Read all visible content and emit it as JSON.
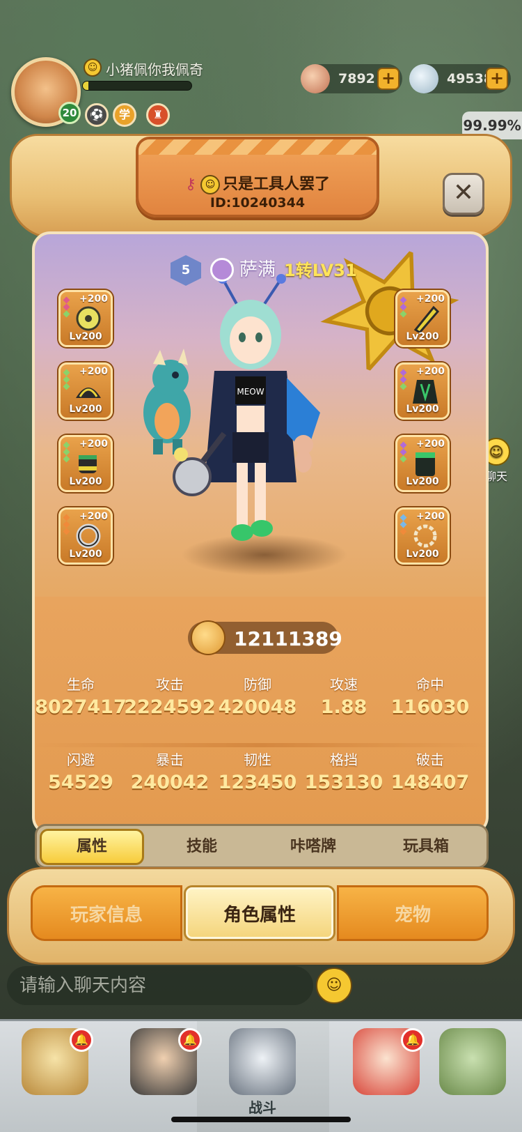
{
  "hud": {
    "player_name": "小猪佩你我佩奇",
    "level": "20",
    "exp_fraction": 0.05,
    "currency": [
      {
        "icon": "meat-icon",
        "value": "7892"
      },
      {
        "icon": "gem-icon",
        "value": "49538"
      }
    ],
    "percent": "99.99%",
    "side_chat_label": "聊天"
  },
  "panel": {
    "player_name": "只是工具人罢了",
    "id_text": "ID:10240344",
    "close_glyph": "✕",
    "rank": "5",
    "class_name": "萨满",
    "class_level": "1转LV31",
    "equipment_left": [
      {
        "plus": "+200",
        "level": "Lv200",
        "item": "cymbal"
      },
      {
        "plus": "+200",
        "level": "Lv200",
        "item": "shoulder-guard"
      },
      {
        "plus": "+200",
        "level": "Lv200",
        "item": "gloves"
      },
      {
        "plus": "+200",
        "level": "Lv200",
        "item": "ring"
      }
    ],
    "equipment_right": [
      {
        "plus": "+200",
        "level": "Lv200",
        "item": "feather"
      },
      {
        "plus": "+200",
        "level": "Lv200",
        "item": "cloak"
      },
      {
        "plus": "+200",
        "level": "Lv200",
        "item": "armor"
      },
      {
        "plus": "+200",
        "level": "Lv200",
        "item": "bracelet"
      }
    ],
    "power": "12111389",
    "stats_row1": [
      {
        "label": "生命",
        "value": "8027417"
      },
      {
        "label": "攻击",
        "value": "2224592"
      },
      {
        "label": "防御",
        "value": "420048"
      },
      {
        "label": "攻速",
        "value": "1.88"
      },
      {
        "label": "命中",
        "value": "116030"
      }
    ],
    "stats_row2": [
      {
        "label": "闪避",
        "value": "54529"
      },
      {
        "label": "暴击",
        "value": "240042"
      },
      {
        "label": "韧性",
        "value": "123450"
      },
      {
        "label": "格挡",
        "value": "153130"
      },
      {
        "label": "破击",
        "value": "148407"
      }
    ],
    "sub_tabs": [
      "属性",
      "技能",
      "咔嗒牌",
      "玩具箱"
    ],
    "active_sub_tab": 0,
    "main_tabs": [
      "玩家信息",
      "角色属性",
      "宠物"
    ],
    "active_main_tab": 1
  },
  "chat": {
    "placeholder": "请输入聊天内容"
  },
  "nav": {
    "battle_label": "战斗"
  },
  "colors": {
    "accent_orange": "#e58a1f",
    "stat_value": "#ffe9a0",
    "class_level": "#ffe45a"
  }
}
